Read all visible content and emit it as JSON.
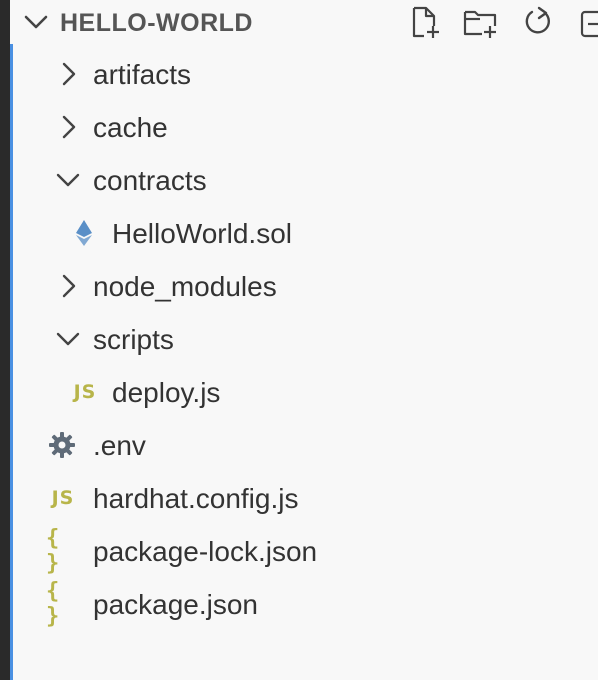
{
  "explorer": {
    "title": "HELLO-WORLD",
    "actions": [
      {
        "icon": "new-file-icon"
      },
      {
        "icon": "new-folder-icon"
      },
      {
        "icon": "refresh-icon"
      },
      {
        "icon": "collapse-all-icon"
      }
    ],
    "items": [
      {
        "label": "artifacts",
        "kind": "folder",
        "expanded": false,
        "depth": 0
      },
      {
        "label": "cache",
        "kind": "folder",
        "expanded": false,
        "depth": 0
      },
      {
        "label": "contracts",
        "kind": "folder",
        "expanded": true,
        "depth": 0
      },
      {
        "label": "HelloWorld.sol",
        "kind": "solidity-file",
        "depth": 1
      },
      {
        "label": "node_modules",
        "kind": "folder",
        "expanded": false,
        "depth": 0
      },
      {
        "label": "scripts",
        "kind": "folder",
        "expanded": true,
        "depth": 0
      },
      {
        "label": "deploy.js",
        "kind": "js-file",
        "depth": 1,
        "glyph": "JS"
      },
      {
        "label": ".env",
        "kind": "env-file",
        "depth": 0
      },
      {
        "label": "hardhat.config.js",
        "kind": "js-file",
        "depth": 0,
        "glyph": "JS"
      },
      {
        "label": "package-lock.json",
        "kind": "json-file",
        "depth": 0,
        "glyph": "{ }"
      },
      {
        "label": "package.json",
        "kind": "json-file",
        "depth": 0,
        "glyph": "{ }"
      }
    ]
  },
  "colors": {
    "accent_border": "#4a90e2",
    "js_icon": "#b8b54a",
    "solidity_icon": "#5a8fc7",
    "gear_icon": "#5f6b78"
  }
}
